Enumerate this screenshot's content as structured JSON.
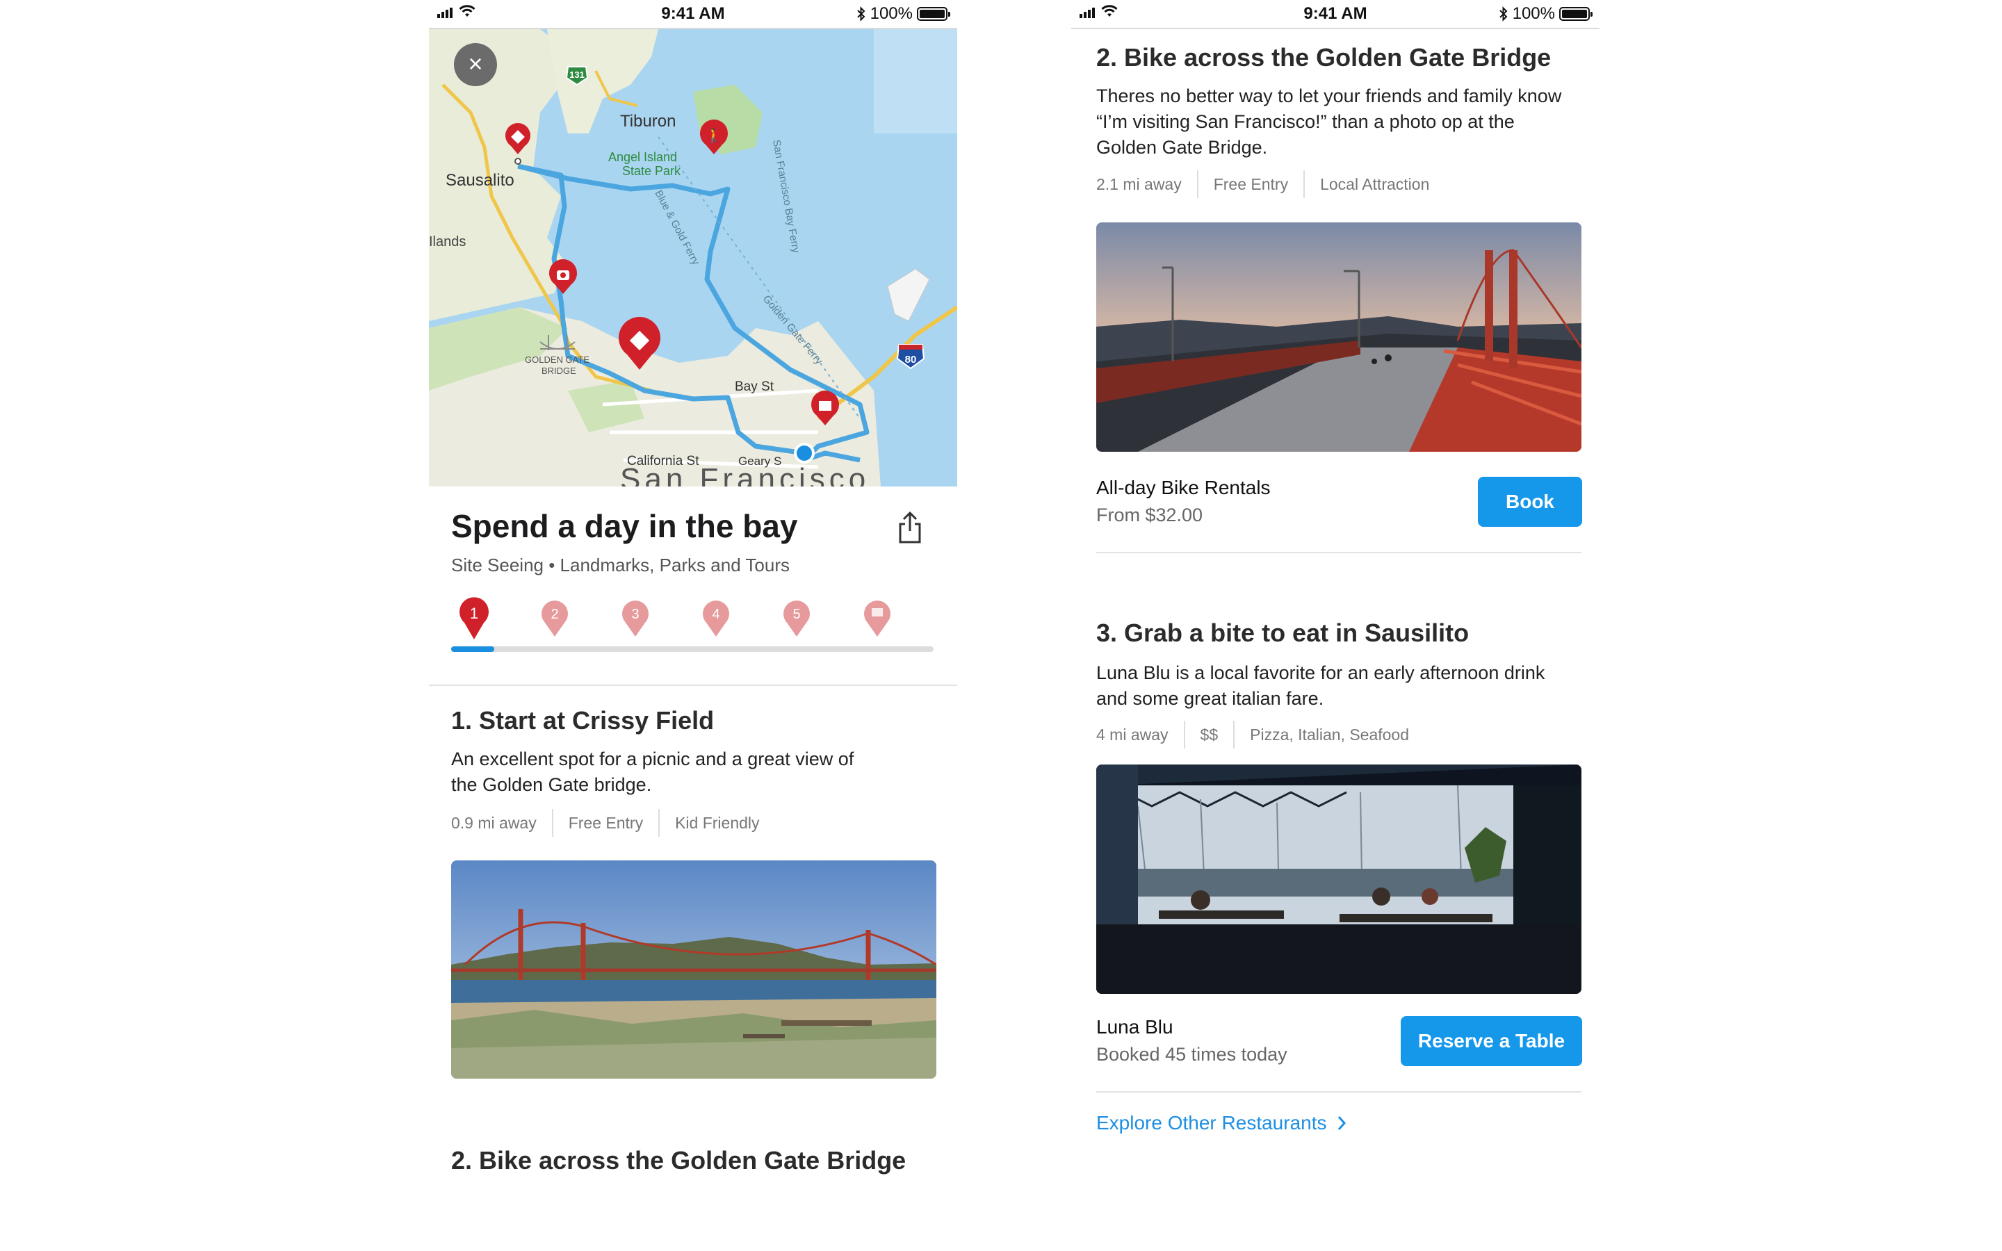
{
  "status_bar": {
    "time": "9:41 AM",
    "battery": "100%"
  },
  "map": {
    "labels": {
      "tiburon": "Tiburon",
      "angel_island": "Angel Island",
      "state_park": "State Park",
      "sausalito": "Sausalito",
      "highlands": "Ilands",
      "golden_gate": "GOLDEN GATE",
      "bridge": "BRIDGE",
      "bay_st": "Bay St",
      "california_st": "California St",
      "geary_st": "Geary S",
      "san_francisco": "San Francisco",
      "blue_gold_ferry": "Blue & Gold Ferry",
      "sf_bay_ferry": "San Francisco Bay Ferry",
      "golden_gate_ferry": "Golden Gate Ferry",
      "route_131": "131",
      "interstate_80": "80"
    },
    "close_icon": "×"
  },
  "trip": {
    "title": "Spend a day in the bay",
    "subtitle": "Site Seeing • Landmarks, Parks and Tours",
    "steps": [
      "1",
      "2",
      "3",
      "4",
      "5",
      "finish"
    ],
    "active_step": 1,
    "progress": 0.09
  },
  "left_sections": {
    "s1": {
      "title": "1. Start at Crissy Field",
      "desc": "An excellent spot for a picnic and a great view of the Golden Gate bridge.",
      "meta": [
        "0.9 mi away",
        "Free Entry",
        "Kid Friendly"
      ]
    },
    "s2_title": "2. Bike across the Golden Gate Bridge"
  },
  "right_sections": {
    "s2": {
      "title": "2. Bike across the Golden Gate Bridge",
      "desc": "Theres no better way to let your friends and family know “I’m visiting San Francisco!” than a photo op at the Golden Gate Bridge.",
      "meta": [
        "2.1 mi away",
        "Free Entry",
        "Local Attraction"
      ],
      "biz_name": "All-day Bike Rentals",
      "biz_sub": "From $32.00",
      "button": "Book"
    },
    "s3": {
      "title": "3. Grab a bite to eat in Sausilito",
      "desc_strong": "Luna Blu",
      "desc": " is a local favorite for an early afternoon drink and some great italian fare.",
      "meta": [
        "4 mi away",
        "$$",
        "Pizza, Italian, Seafood"
      ],
      "biz_name": "Luna Blu",
      "biz_sub": "Booked 45 times today",
      "button": "Reserve a Table"
    },
    "explore_link": "Explore Other Restaurants"
  },
  "colors": {
    "accent": "#1597ea",
    "pin_active": "#d0202a",
    "pin_inactive": "#e79a9c",
    "route": "#4ba6e0"
  }
}
